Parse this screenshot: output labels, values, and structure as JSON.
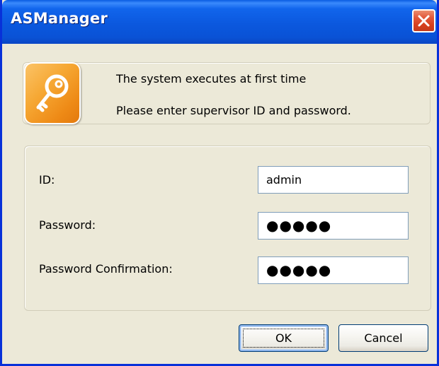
{
  "window": {
    "title": "ASManager",
    "close_icon": "close-icon"
  },
  "header": {
    "icon": "key-icon",
    "message_line1": "The system executes at first time",
    "message_line2": "Please enter supervisor ID and password."
  },
  "form": {
    "id_label": "ID:",
    "id_value": "admin",
    "password_label": "Password:",
    "password_value": "●●●●●",
    "confirm_label": "Password Confirmation:",
    "confirm_value": "●●●●●"
  },
  "buttons": {
    "ok_label": "OK",
    "cancel_label": "Cancel"
  },
  "colors": {
    "titlebar": "#0a5de2",
    "window_bg": "#ece9d8",
    "close_button": "#d6401d",
    "icon_bg": "#f6a834"
  }
}
